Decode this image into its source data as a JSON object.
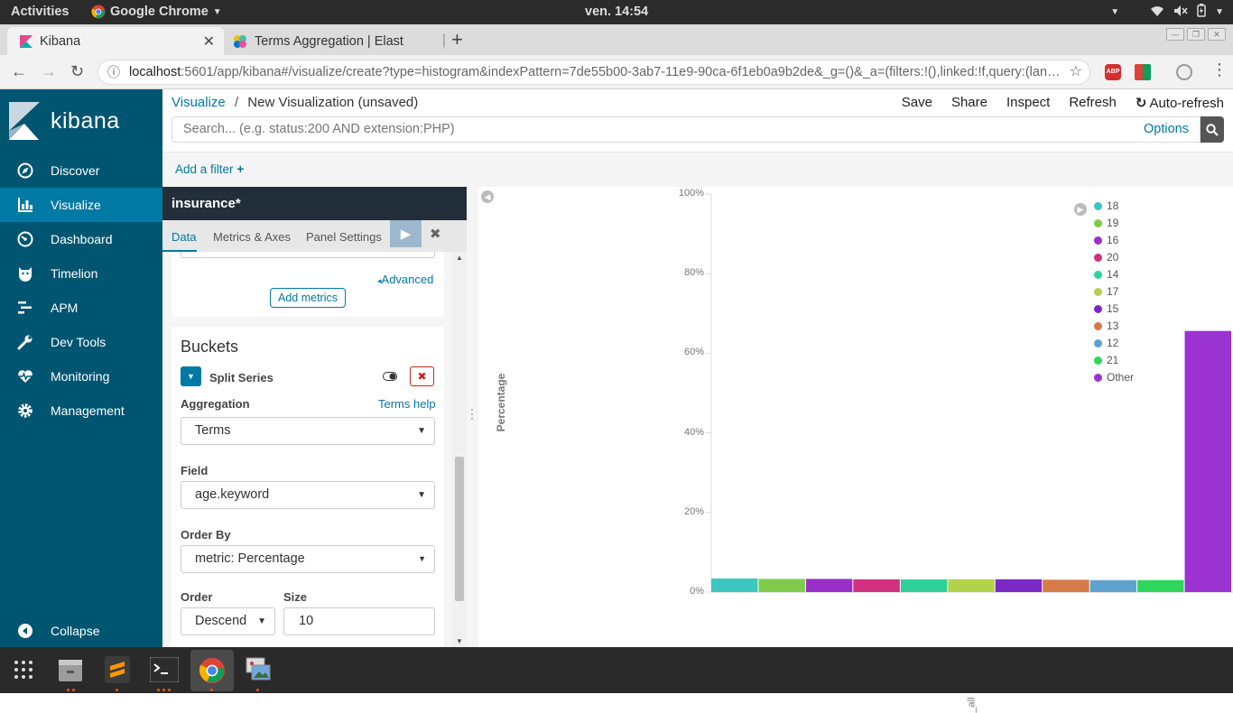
{
  "system": {
    "activities": "Activities",
    "app_name": "Google Chrome",
    "clock": "ven. 14:54"
  },
  "browser": {
    "tabs": [
      {
        "title": "Kibana"
      },
      {
        "title": "Terms Aggregation | Elast"
      }
    ],
    "url_host": "localhost",
    "url_rest": ":5601/app/kibana#/visualize/create?type=histogram&indexPattern=7de55b00-3ab7-11e9-90ca-6f1eb0a9b2de&_g=()&_a=(filters:!(),linked:!f,query:(lan…"
  },
  "sidebar": {
    "brand": "kibana",
    "items": [
      {
        "label": "Discover",
        "icon": "compass-icon"
      },
      {
        "label": "Visualize",
        "icon": "bar-chart-icon"
      },
      {
        "label": "Dashboard",
        "icon": "gauge-icon"
      },
      {
        "label": "Timelion",
        "icon": "timelion-icon"
      },
      {
        "label": "APM",
        "icon": "apm-icon"
      },
      {
        "label": "Dev Tools",
        "icon": "wrench-icon"
      },
      {
        "label": "Monitoring",
        "icon": "heartbeat-icon"
      },
      {
        "label": "Management",
        "icon": "gear-icon"
      }
    ],
    "collapse": "Collapse"
  },
  "header": {
    "breadcrumb_root": "Visualize",
    "breadcrumb_sep": "/",
    "breadcrumb_current": "New Visualization (unsaved)",
    "menu": [
      "Save",
      "Share",
      "Inspect",
      "Refresh",
      "Auto-refresh"
    ],
    "search_placeholder": "Search... (e.g. status:200 AND extension:PHP)",
    "options": "Options",
    "add_filter": "Add a filter"
  },
  "editor": {
    "index": "insurance*",
    "tabs": [
      "Data",
      "Metrics & Axes",
      "Panel Settings"
    ],
    "advanced": "Advanced",
    "add_metrics": "Add metrics",
    "buckets_title": "Buckets",
    "bucket_type": "Split Series",
    "aggregation_label": "Aggregation",
    "aggregation_help": "Terms help",
    "aggregation_value": "Terms",
    "field_label": "Field",
    "field_value": "age.keyword",
    "orderby_label": "Order By",
    "orderby_value": "metric: Percentage",
    "order_label": "Order",
    "order_value": "Descend",
    "size_label": "Size",
    "size_value": "10"
  },
  "chart_data": {
    "type": "bar",
    "ylabel": "Percentage",
    "xlabel": "_all",
    "ylim": [
      0,
      100
    ],
    "yticks": [
      "0%",
      "20%",
      "40%",
      "60%",
      "80%",
      "100%"
    ],
    "categories": [
      "_all"
    ],
    "series": [
      {
        "name": "18",
        "values": [
          3.4
        ],
        "color": "#3ec6c0"
      },
      {
        "name": "19",
        "values": [
          3.3
        ],
        "color": "#7fcc4d"
      },
      {
        "name": "16",
        "values": [
          3.3
        ],
        "color": "#9a2fc8"
      },
      {
        "name": "20",
        "values": [
          3.2
        ],
        "color": "#d1307e"
      },
      {
        "name": "14",
        "values": [
          3.2
        ],
        "color": "#2ed19a"
      },
      {
        "name": "17",
        "values": [
          3.2
        ],
        "color": "#b3d24b"
      },
      {
        "name": "15",
        "values": [
          3.2
        ],
        "color": "#7b29c7"
      },
      {
        "name": "13",
        "values": [
          3.1
        ],
        "color": "#d57a48"
      },
      {
        "name": "12",
        "values": [
          3.0
        ],
        "color": "#5ea3cf"
      },
      {
        "name": "21",
        "values": [
          3.0
        ],
        "color": "#2fd65a"
      },
      {
        "name": "Other",
        "values": [
          65.6
        ],
        "color": "#9a33d1"
      }
    ]
  }
}
